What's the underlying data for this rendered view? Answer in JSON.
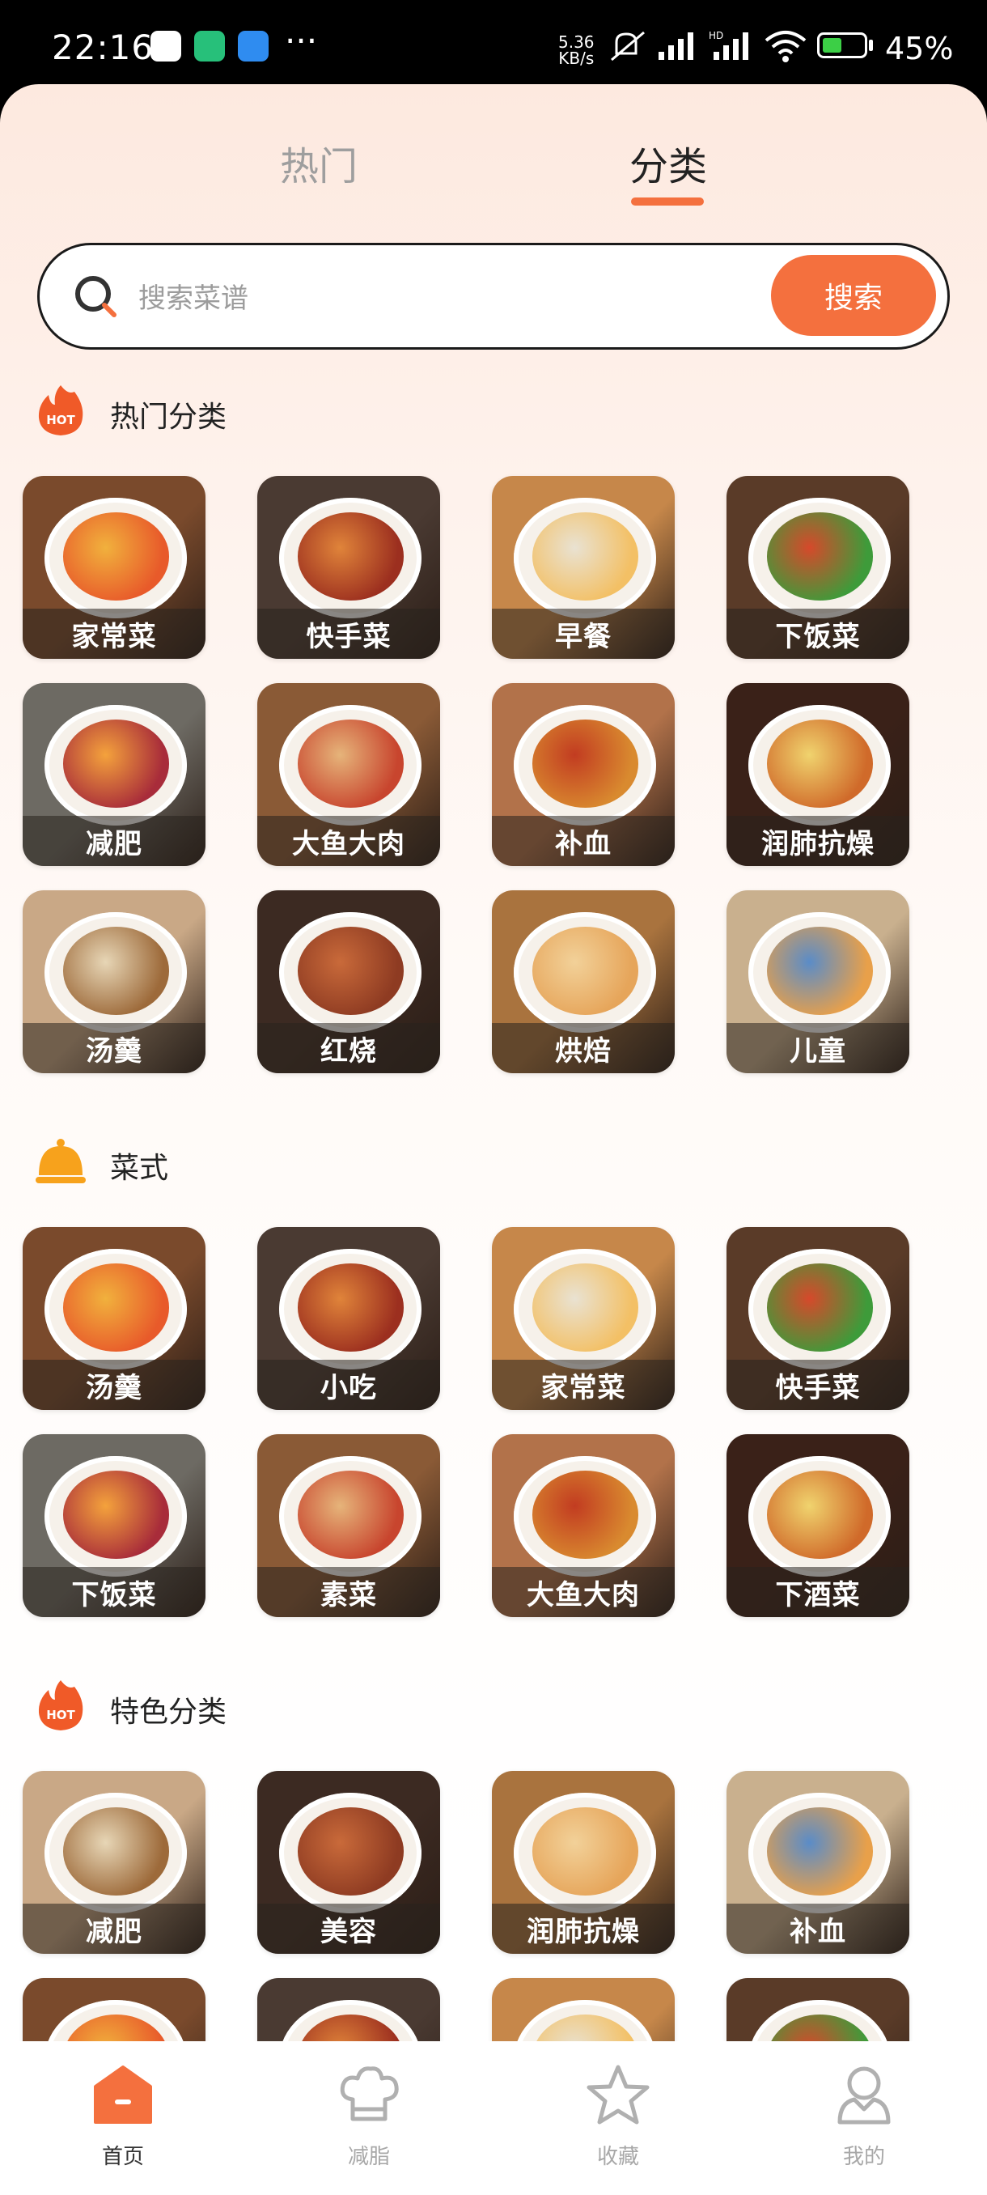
{
  "status_bar": {
    "time": "22:16",
    "dots": "···",
    "net_speed_value": "5.36",
    "net_speed_unit": "KB/s",
    "battery": "45%",
    "battery_level_percent": 45
  },
  "tabs": [
    {
      "label": "热门",
      "active": false
    },
    {
      "label": "分类",
      "active": true
    }
  ],
  "search": {
    "placeholder": "搜索菜谱",
    "button_label": "搜索"
  },
  "sections": [
    {
      "title": "热门分类",
      "icon": "hot-flame-icon",
      "items": [
        {
          "label": "家常菜",
          "icon": "dish-home-style"
        },
        {
          "label": "快手菜",
          "icon": "dish-quick"
        },
        {
          "label": "早餐",
          "icon": "dish-breakfast"
        },
        {
          "label": "下饭菜",
          "icon": "dish-rice-side"
        },
        {
          "label": "减肥",
          "icon": "dish-diet"
        },
        {
          "label": "大鱼大肉",
          "icon": "dish-fish-meat"
        },
        {
          "label": "补血",
          "icon": "dish-blood-tonic"
        },
        {
          "label": "润肺抗燥",
          "icon": "dish-lung-moisten"
        },
        {
          "label": "汤羹",
          "icon": "dish-soup"
        },
        {
          "label": "红烧",
          "icon": "dish-braised"
        },
        {
          "label": "烘焙",
          "icon": "dish-baking"
        },
        {
          "label": "儿童",
          "icon": "dish-kids"
        }
      ]
    },
    {
      "title": "菜式",
      "icon": "food-cloche-icon",
      "items": [
        {
          "label": "汤羹",
          "icon": "dish-soup-2"
        },
        {
          "label": "小吃",
          "icon": "dish-snack"
        },
        {
          "label": "家常菜",
          "icon": "dish-home-style-2"
        },
        {
          "label": "快手菜",
          "icon": "dish-quick-2"
        },
        {
          "label": "下饭菜",
          "icon": "dish-rice-side-2"
        },
        {
          "label": "素菜",
          "icon": "dish-vegetarian"
        },
        {
          "label": "大鱼大肉",
          "icon": "dish-fish-meat-2"
        },
        {
          "label": "下酒菜",
          "icon": "dish-drink-snack"
        }
      ]
    },
    {
      "title": "特色分类",
      "icon": "hot-flame-icon",
      "items": [
        {
          "label": "减肥",
          "icon": "dish-diet-2"
        },
        {
          "label": "美容",
          "icon": "dish-beauty"
        },
        {
          "label": "润肺抗燥",
          "icon": "dish-lung-moisten-2"
        },
        {
          "label": "补血",
          "icon": "dish-blood-tonic-2"
        },
        {
          "label": "",
          "icon": "dish-partial-1"
        },
        {
          "label": "",
          "icon": "dish-partial-2"
        },
        {
          "label": "",
          "icon": "dish-partial-3"
        },
        {
          "label": "",
          "icon": "dish-partial-4"
        }
      ]
    }
  ],
  "bottom_nav": [
    {
      "label": "首页",
      "icon": "home-icon",
      "active": true
    },
    {
      "label": "减脂",
      "icon": "chef-hat-icon",
      "active": false
    },
    {
      "label": "收藏",
      "icon": "star-icon",
      "active": false
    },
    {
      "label": "我的",
      "icon": "user-icon",
      "active": false
    }
  ],
  "colors": {
    "accent": "#f4703e",
    "text_dark": "#222222",
    "text_muted": "#9e9e9e",
    "hot_icon": "#f05a28",
    "cloche_icon": "#f7a21c"
  }
}
